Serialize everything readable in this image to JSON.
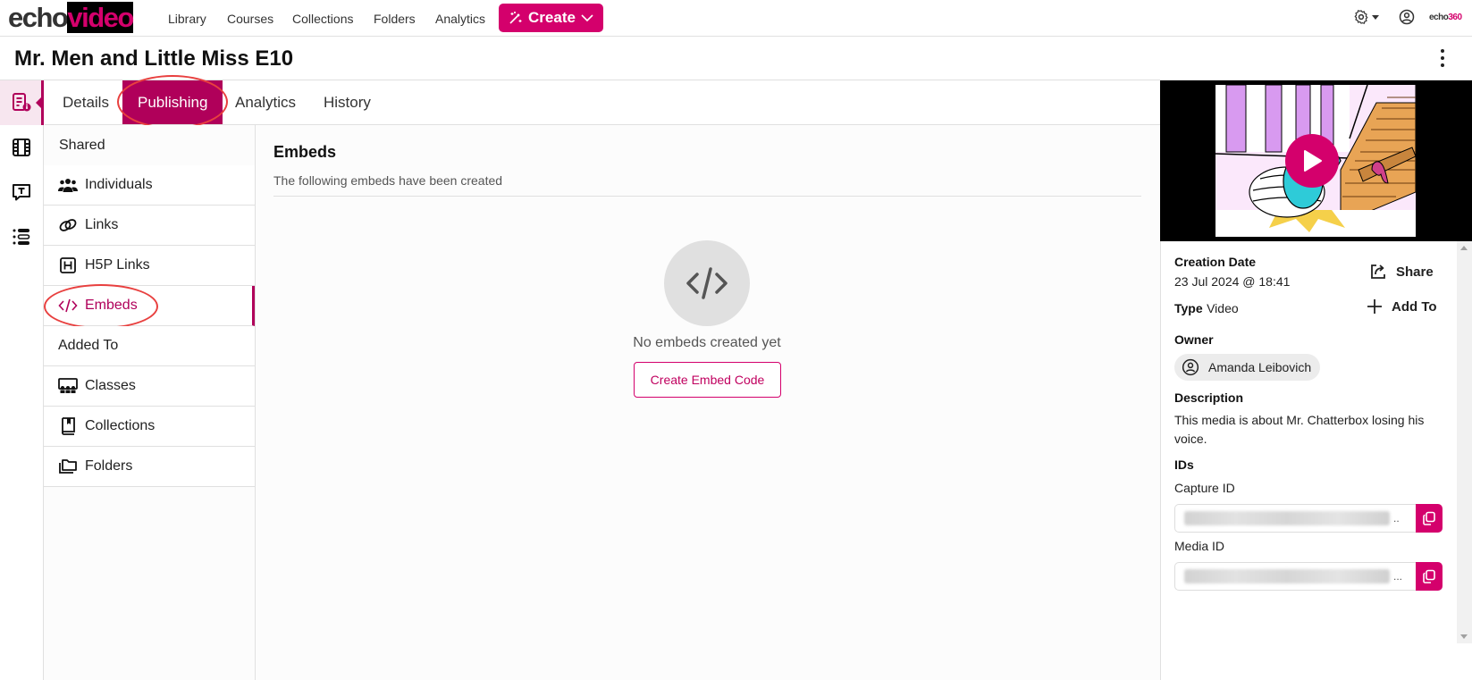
{
  "app": {
    "logo_part1": "echo",
    "logo_part2": "video",
    "brand_color": "#d4006c",
    "active_color": "#b0005a",
    "nav": [
      "Library",
      "Courses",
      "Collections",
      "Folders",
      "Analytics"
    ],
    "create_label": "Create",
    "corner_logo_part1": "echo",
    "corner_logo_part2": "360",
    "icons": {
      "settings": "gear-icon",
      "account": "user-circle-icon",
      "more": "kebab-icon"
    }
  },
  "page": {
    "title": "Mr. Men and Little Miss E10"
  },
  "rail": {
    "items": [
      {
        "icon": "media-details-icon",
        "active": true
      },
      {
        "icon": "film-icon",
        "active": false
      },
      {
        "icon": "captions-icon",
        "active": false
      },
      {
        "icon": "list-settings-icon",
        "active": false
      }
    ]
  },
  "tabs": [
    {
      "label": "Details",
      "active": false
    },
    {
      "label": "Publishing",
      "active": true
    },
    {
      "label": "Analytics",
      "active": false
    },
    {
      "label": "History",
      "active": false
    }
  ],
  "subnav": {
    "shared_heading": "Shared",
    "shared_items": [
      {
        "label": "Individuals",
        "icon": "people-icon"
      },
      {
        "label": "Links",
        "icon": "link-icon"
      },
      {
        "label": "H5P Links",
        "icon": "h5p-icon"
      },
      {
        "label": "Embeds",
        "icon": "code-icon",
        "active": true
      }
    ],
    "added_heading": "Added To",
    "added_items": [
      {
        "label": "Classes",
        "icon": "classroom-icon"
      },
      {
        "label": "Collections",
        "icon": "book-icon"
      },
      {
        "label": "Folders",
        "icon": "folders-icon"
      }
    ]
  },
  "main": {
    "heading": "Embeds",
    "subtitle": "The following embeds have been created",
    "empty_text": "No embeds created yet",
    "create_button": "Create Embed Code"
  },
  "details": {
    "creation_date_label": "Creation Date",
    "creation_date_value": "23 Jul 2024 @ 18:41",
    "share_label": "Share",
    "type_label": "Type",
    "type_value": "Video",
    "add_to_label": "Add To",
    "owner_label": "Owner",
    "owner_name": "Amanda Leibovich",
    "description_label": "Description",
    "description_value": "This media is about Mr. Chatterbox losing his voice.",
    "ids_label": "IDs",
    "capture_id_label": "Capture ID",
    "media_id_label": "Media ID",
    "id_values_redacted": true
  }
}
